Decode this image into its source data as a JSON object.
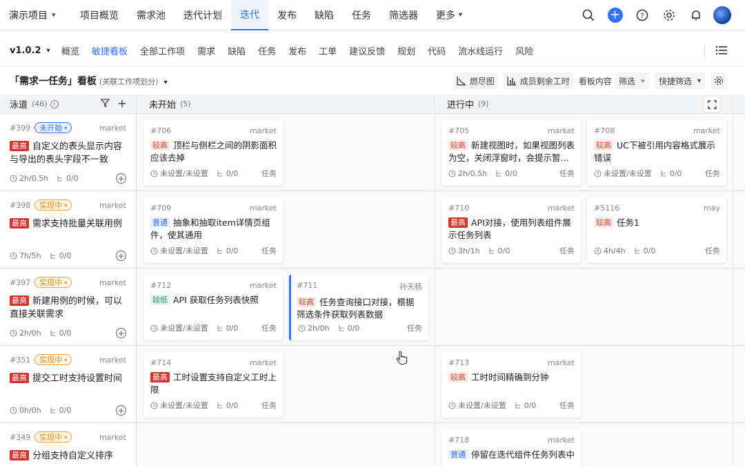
{
  "topnav": {
    "project": "演示项目",
    "items": [
      "项目概览",
      "需求池",
      "迭代计划",
      "迭代",
      "发布",
      "缺陷",
      "任务",
      "筛选器",
      "更多"
    ]
  },
  "subnav": {
    "version": "v1.0.2",
    "items": [
      "概览",
      "敏捷看板",
      "全部工作项",
      "需求",
      "缺陷",
      "任务",
      "发布",
      "工单",
      "建议反馈",
      "规划",
      "代码",
      "流水线运行",
      "风险"
    ]
  },
  "board": {
    "title": "「需求一任务」看板",
    "subtitle": "(关联工作项划分)",
    "burndown": "燃尽图",
    "member_hours": "成员剩余工时",
    "content_label": "看板内容",
    "filter": "筛选",
    "quick_filter": "快捷筛选"
  },
  "columns": {
    "lane": {
      "label": "泳道",
      "count": "(46)"
    },
    "todo": {
      "label": "未开始",
      "count": "(5)"
    },
    "doing": {
      "label": "进行中",
      "count": "(9)"
    }
  },
  "lanes": [
    {
      "id": "#399",
      "status": "未开始",
      "owner": "market",
      "prio": "最高",
      "title": "自定义的表头显示内容与导出的表头字段不一致",
      "time": "2h/0.5h",
      "sub": "0/0"
    },
    {
      "id": "#398",
      "status": "实现中",
      "owner": "market",
      "prio": "最高",
      "title": "需求支持批量关联用例",
      "time": "7h/5h",
      "sub": "0/0"
    },
    {
      "id": "#397",
      "status": "实现中",
      "owner": "market",
      "prio": "最高",
      "title": "新建用例的时候，可以直接关联需求",
      "time": "2h/0h",
      "sub": "0/0"
    },
    {
      "id": "#351",
      "status": "实现中",
      "owner": "market",
      "prio": "最高",
      "title": "提交工时支持设置时间",
      "time": "0h/0h",
      "sub": "0/0"
    },
    {
      "id": "#349",
      "status": "实现中",
      "owner": "market",
      "prio": "最高",
      "title": "分组支持自定义排序",
      "time": "",
      "sub": ""
    }
  ],
  "cards": [
    {
      "id": "#706",
      "owner": "market",
      "prio": "较高",
      "title": "顶栏与侧栏之间的阴影面积应该去掉",
      "time": "未设置/未设置",
      "sub": "0/0",
      "type": "任务"
    },
    {
      "id": "#705",
      "owner": "market",
      "prio": "较高",
      "title": "新建视图时，如果视图列表为空，关闭浮窗时，会提示暂…",
      "time": "2h/0.5h",
      "sub": "0/0",
      "type": "任务"
    },
    {
      "id": "#708",
      "owner": "market",
      "prio": "较高",
      "title": "UC下被引用内容格式展示错误",
      "time": "未设置/未设置",
      "sub": "0/0",
      "type": "任务"
    },
    {
      "id": "#709",
      "owner": "market",
      "prio": "普通",
      "title": "抽象和抽取item详情页组件，使其通用",
      "time": "未设置/未设置",
      "sub": "0/0",
      "type": "任务"
    },
    {
      "id": "#710",
      "owner": "market",
      "prio": "最高",
      "title": "API对接，使用列表组件展示任务列表",
      "time": "3h/1h",
      "sub": "0/0",
      "type": "任务"
    },
    {
      "id": "#5116",
      "owner": "may",
      "prio": "较高",
      "title": "任务1",
      "time": "4h/4h",
      "sub": "0/0",
      "type": "任务"
    },
    {
      "id": "#712",
      "owner": "market",
      "prio": "较低",
      "title": "API 获取任务列表快照",
      "time": "未设置/未设置",
      "sub": "0/0",
      "type": "任务"
    },
    {
      "id": "#711",
      "owner": "孙天杨",
      "prio": "较高",
      "title": "任务查询接口对接，根据筛选条件获取列表数据",
      "time": "2h/0h",
      "sub": "0/0",
      "type": "任务"
    },
    {
      "id": "#714",
      "owner": "market",
      "prio": "最高",
      "title": "工时设置支持自定义工时上限",
      "time": "未设置/未设置",
      "sub": "0/0",
      "type": "任务"
    },
    {
      "id": "#713",
      "owner": "market",
      "prio": "较高",
      "title": "工时时间精确到分钟",
      "time": "未设置/未设置",
      "sub": "0/0",
      "type": "任务"
    },
    {
      "id": "#718",
      "owner": "market",
      "prio": "普通",
      "title": "停留在迭代组件任务列表中",
      "time": "",
      "sub": "",
      "type": ""
    }
  ],
  "colors": {
    "accent": "#3370ff",
    "top_prio": "#d9342b",
    "doing": "#e68a00"
  }
}
